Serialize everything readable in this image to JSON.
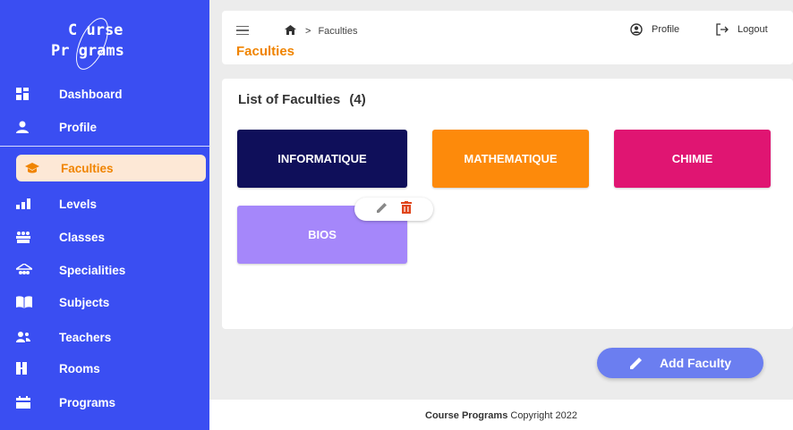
{
  "app": {
    "logo_line1": "C  urse",
    "logo_line2": "Pr  grams"
  },
  "sidebar": {
    "items": [
      {
        "label": "Dashboard",
        "icon": "dashboard-icon"
      },
      {
        "label": "Profile",
        "icon": "person-icon"
      },
      {
        "label": "Faculties",
        "icon": "graduation-cap-icon",
        "active": true
      },
      {
        "label": "Levels",
        "icon": "bar-chart-icon"
      },
      {
        "label": "Classes",
        "icon": "group-icon"
      },
      {
        "label": "Specialities",
        "icon": "network-icon"
      },
      {
        "label": "Subjects",
        "icon": "book-icon"
      },
      {
        "label": "Teachers",
        "icon": "users-icon"
      },
      {
        "label": "Rooms",
        "icon": "door-icon"
      },
      {
        "label": "Programs",
        "icon": "calendar-icon"
      }
    ]
  },
  "header": {
    "breadcrumb_current": "Faculties",
    "breadcrumb_sep": ">",
    "page_title": "Faculties",
    "profile_label": "Profile",
    "logout_label": "Logout"
  },
  "list": {
    "title": "List of Faculties",
    "count": "(4)",
    "faculties": [
      {
        "name": "INFORMATIQUE",
        "color": "#0f0f5a"
      },
      {
        "name": "MATHEMATIQUE",
        "color": "#fd8a0b"
      },
      {
        "name": "CHIMIE",
        "color": "#e01572"
      },
      {
        "name": "BIOS",
        "color": "#a587fa"
      }
    ]
  },
  "actions": {
    "add_label": "Add Faculty"
  },
  "footer": {
    "brand": "Course Programs",
    "text": "Copyright 2022"
  },
  "colors": {
    "sidebar": "#3a4ef2",
    "accent": "#f08400",
    "fab": "#6b7ef0"
  }
}
